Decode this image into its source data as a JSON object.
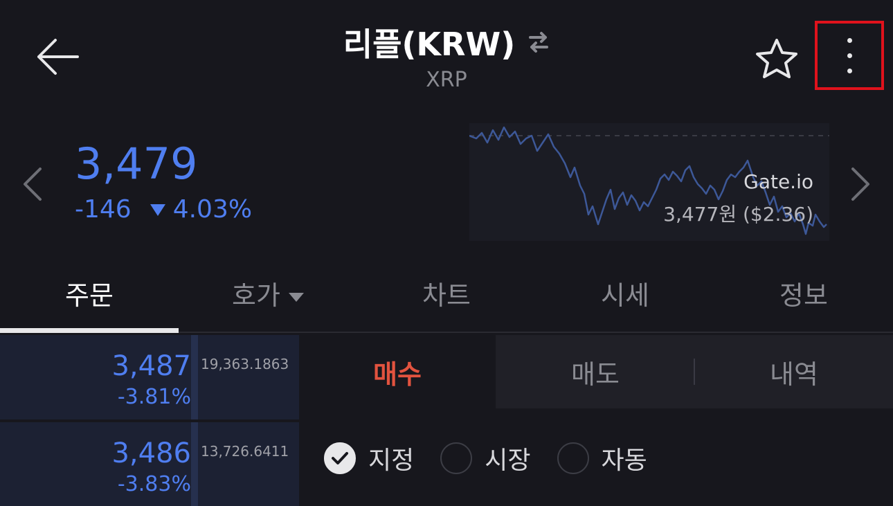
{
  "header": {
    "title": "리플(KRW)",
    "subtitle": "XRP"
  },
  "ticker": {
    "price": "3,479",
    "change_amount": "-146",
    "change_rate": "4.03%",
    "exchange": "Gate.io",
    "reference_price": "3,477원 ($2.36)"
  },
  "tabs": [
    {
      "label": "주문",
      "active": true
    },
    {
      "label": "호가",
      "active": false
    },
    {
      "label": "차트",
      "active": false
    },
    {
      "label": "시세",
      "active": false
    },
    {
      "label": "정보",
      "active": false
    }
  ],
  "orderbook": [
    {
      "price": "3,487",
      "rate": "-3.81%",
      "qty": "19,363.1863"
    },
    {
      "price": "3,486",
      "rate": "-3.83%",
      "qty": "13,726.6411"
    }
  ],
  "order_tabs": {
    "buy": "매수",
    "sell": "매도",
    "history": "내역"
  },
  "order_types": [
    {
      "label": "지정",
      "checked": true
    },
    {
      "label": "시장",
      "checked": false
    },
    {
      "label": "자동",
      "checked": false
    }
  ],
  "colors": {
    "background": "#17171d",
    "price_blue": "#4f7ef0",
    "buy_red": "#e2533f",
    "highlight_border": "#e0121c"
  }
}
